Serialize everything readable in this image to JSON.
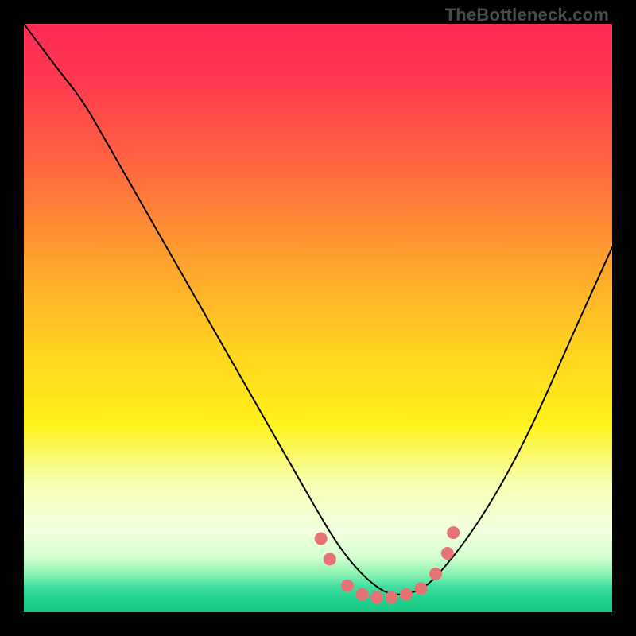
{
  "watermark": "TheBottleneck.com",
  "chart_data": {
    "type": "line",
    "title": "",
    "xlabel": "",
    "ylabel": "",
    "xlim": [
      0,
      100
    ],
    "ylim": [
      0,
      100
    ],
    "grid": false,
    "legend": false,
    "background_gradient": {
      "stops": [
        {
          "offset": 0.0,
          "color": "#ff2a55"
        },
        {
          "offset": 0.1,
          "color": "#ff3a4f"
        },
        {
          "offset": 0.25,
          "color": "#ff6a3f"
        },
        {
          "offset": 0.4,
          "color": "#ffa12f"
        },
        {
          "offset": 0.55,
          "color": "#ffd21f"
        },
        {
          "offset": 0.68,
          "color": "#fff21a"
        },
        {
          "offset": 0.78,
          "color": "#f8ffb0"
        },
        {
          "offset": 0.86,
          "color": "#f2ffe0"
        },
        {
          "offset": 0.905,
          "color": "#d6ffd0"
        },
        {
          "offset": 0.935,
          "color": "#8cf3b2"
        },
        {
          "offset": 0.955,
          "color": "#46e0a0"
        },
        {
          "offset": 0.975,
          "color": "#22d38f"
        },
        {
          "offset": 1.0,
          "color": "#18c781"
        }
      ]
    },
    "series": [
      {
        "name": "bottleneck-curve",
        "stroke": "#000000",
        "stroke_width": 2,
        "x": [
          0,
          3,
          6,
          10,
          14,
          18,
          22,
          26,
          30,
          34,
          38,
          42,
          46,
          50,
          53,
          56,
          59,
          62,
          65,
          68,
          71,
          75,
          79,
          83,
          87,
          91,
          95,
          100
        ],
        "y": [
          100,
          96,
          92,
          87,
          80,
          73,
          66,
          59,
          52,
          45,
          38,
          31,
          24,
          17,
          12,
          8,
          5,
          3,
          3,
          4,
          7,
          12,
          18,
          25,
          33,
          42,
          51,
          62
        ]
      }
    ],
    "markers": {
      "name": "highlight-points",
      "color": "#e57373",
      "radius": 8,
      "points": [
        {
          "x": 50.5,
          "y": 12.5
        },
        {
          "x": 52.0,
          "y": 9.0
        },
        {
          "x": 55.0,
          "y": 4.5
        },
        {
          "x": 57.5,
          "y": 3.0
        },
        {
          "x": 60.0,
          "y": 2.5
        },
        {
          "x": 62.5,
          "y": 2.5
        },
        {
          "x": 65.0,
          "y": 3.0
        },
        {
          "x": 67.5,
          "y": 4.0
        },
        {
          "x": 70.0,
          "y": 6.5
        },
        {
          "x": 72.0,
          "y": 10.0
        },
        {
          "x": 73.0,
          "y": 13.5
        }
      ]
    }
  }
}
